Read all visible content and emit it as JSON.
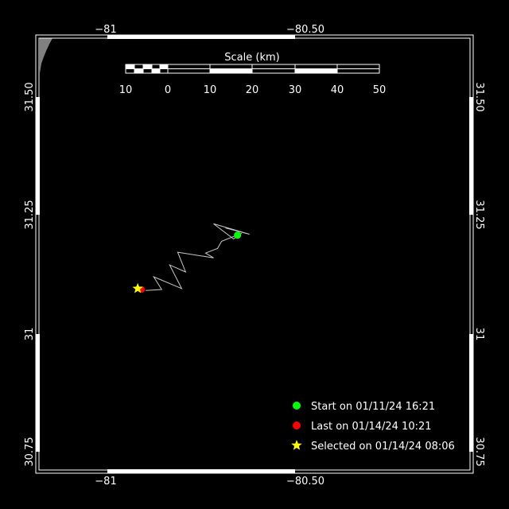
{
  "map": {
    "background": "#000000",
    "frame_color": "#ffffff",
    "land_color": "#808080",
    "track_color": "#c8c8c8",
    "lon_labels_top": [
      "−81",
      "−80.50"
    ],
    "lon_labels_bottom": [
      "−81",
      "−80.50"
    ],
    "lat_labels_left": [
      "31.50",
      "31.25",
      "31",
      "30.75"
    ],
    "lat_labels_right": [
      "31.50",
      "31.25",
      "31",
      "30.75"
    ],
    "extent": {
      "lon_min": -81.3,
      "lon_max": -80.1,
      "lat_min": 30.72,
      "lat_max": 31.6
    }
  },
  "scale_bar": {
    "title": "Scale (km)",
    "ticks": [
      "10",
      "0",
      "10",
      "20",
      "30",
      "40",
      "50"
    ]
  },
  "track": {
    "points": [
      [
        -80.7,
        31.223
      ],
      [
        -80.64,
        31.21
      ],
      [
        -80.73,
        31.232
      ],
      [
        -80.68,
        31.2
      ],
      [
        -80.66,
        31.212
      ],
      [
        -80.71,
        31.195
      ],
      [
        -80.72,
        31.18
      ],
      [
        -80.75,
        31.17
      ],
      [
        -80.73,
        31.16
      ],
      [
        -80.82,
        31.172
      ],
      [
        -80.8,
        31.13
      ],
      [
        -80.84,
        31.145
      ],
      [
        -80.81,
        31.095
      ],
      [
        -80.88,
        31.12
      ],
      [
        -80.86,
        31.093
      ],
      [
        -80.9,
        31.091
      ]
    ],
    "start": [
      -80.67,
      31.208
    ],
    "last": [
      -80.91,
      31.093
    ],
    "selected": [
      -80.92,
      31.095
    ]
  },
  "legend": {
    "start": {
      "label": "Start on 01/11/24 16:21",
      "color": "#00ff00"
    },
    "last": {
      "label": "Last on 01/14/24 10:21",
      "color": "#ff0000"
    },
    "selected": {
      "label": "Selected on 01/14/24 08:06",
      "color": "#ffff00"
    }
  }
}
